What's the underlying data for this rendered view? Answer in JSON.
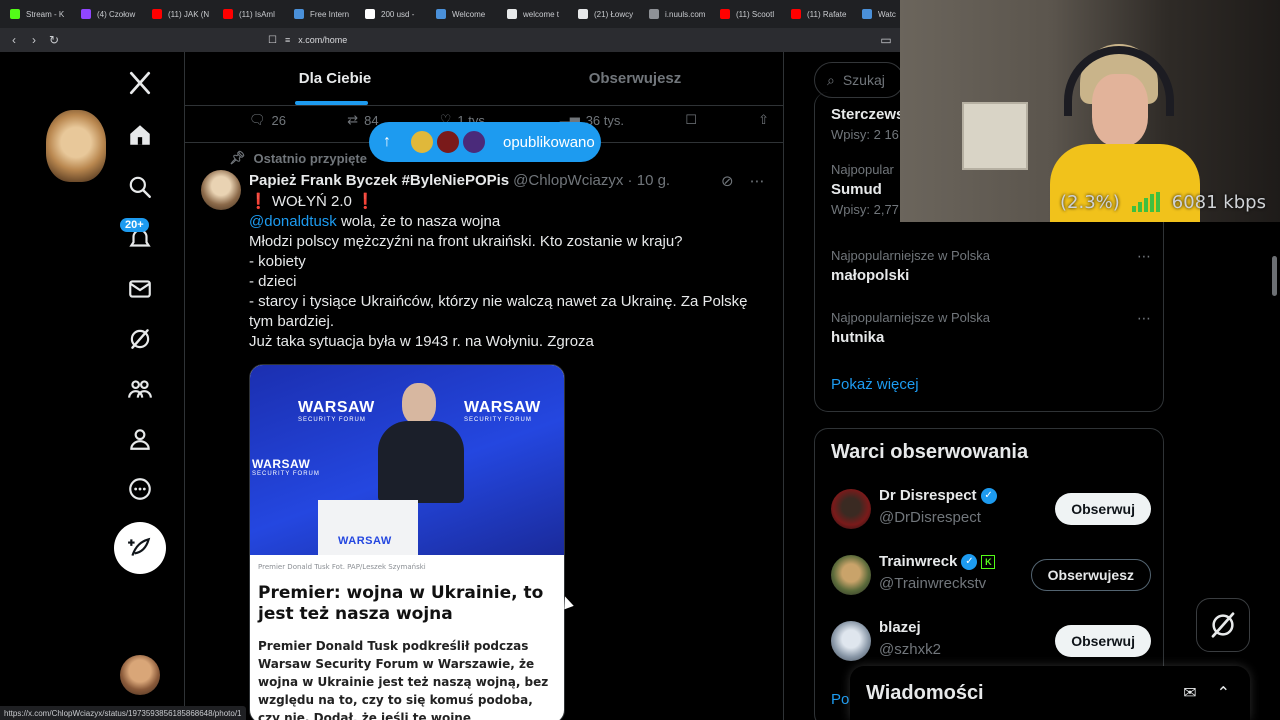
{
  "browser": {
    "tabs": [
      {
        "label": "Stream - K",
        "color": "#53fc18"
      },
      {
        "label": "(4) Czołow",
        "color": "#9146ff"
      },
      {
        "label": "(11) JAK (N",
        "color": "#ff0000"
      },
      {
        "label": "(11) IsAml",
        "color": "#ff0000"
      },
      {
        "label": "Free Intern",
        "color": "#4a90d9"
      },
      {
        "label": "200 usd -",
        "color": "#ffffff"
      },
      {
        "label": "Welcome",
        "color": "#4a90d9"
      },
      {
        "label": "welcome t",
        "color": "#e7e9ea"
      },
      {
        "label": "(21) Łowcy",
        "color": "#e7e9ea"
      },
      {
        "label": "i.nuuls.com",
        "color": "#8e9196"
      },
      {
        "label": "(11) Scootl",
        "color": "#ff0000"
      },
      {
        "label": "(11) Rafate",
        "color": "#ff0000"
      },
      {
        "label": "Watc",
        "color": "#4a90d9"
      }
    ],
    "url": "x.com/home",
    "status_url": "https://x.com/ChlopWciazyx/status/1973593856185868648/photo/1"
  },
  "nav": {
    "notifications_badge": "20+"
  },
  "feed": {
    "tab_for_you": "Dla Ciebie",
    "tab_following": "Obserwujesz",
    "prev_actions": {
      "replies": "26",
      "reposts": "84",
      "likes": "1 tys.",
      "views": "36 tys."
    },
    "new_posts_pill": "opublikowano",
    "pinned_label": "Ostatnio przypięte",
    "tweet": {
      "author_name": "Papież Frank Byczek #ByleNiePOPis",
      "handle_time": "@ChlopWciazyx · 10 g.",
      "line1": "❗ WOŁYŃ 2.0 ❗",
      "mention": "@donaldtusk",
      "line2_rest": " wola, że to nasza wojna",
      "line3": "Młodzi polscy mężczyźni na front ukraiński. Kto zostanie w kraju?",
      "line4": "- kobiety",
      "line5": "- dzieci",
      "line6": "- starcy i tysiące Ukraińców, którzy nie walczą nawet za Ukrainę. Za Polskę tym bardziej.",
      "line7": "Już taka sytuacja była w 1943 r. na Wołyniu. Zgroza",
      "card": {
        "banner_word": "WARSAW",
        "banner_sub": "SECURITY FORUM",
        "caption": "Premier Donald Tusk Fot. PAP/Leszek Szymański",
        "title": "Premier: wojna w Ukrainie, to jest też nasza wojna",
        "body": "Premier Donald Tusk podkreślił podczas Warsaw Security Forum w Warszawie, że wojna w Ukrainie jest też naszą wojną, bez względu na to, czy to się komuś podoba, czy nie. Dodał, że jeśli tę wojnę"
      }
    }
  },
  "sidebar": {
    "search_placeholder": "Szukaj",
    "trends": [
      {
        "category": "",
        "name": "Sterczewsk",
        "sub": "Wpisy: 2 16"
      },
      {
        "category": "Najpopular",
        "name": "Sumud",
        "sub": "Wpisy: 2,77 mln"
      },
      {
        "category": "Najpopularniejsze w Polska",
        "name": "małopolski",
        "sub": ""
      },
      {
        "category": "Najpopularniejsze w Polska",
        "name": "hutnika",
        "sub": ""
      }
    ],
    "show_more": "Pokaż więcej",
    "who_to_follow_title": "Warci obserwowania",
    "follow": [
      {
        "name": "Dr Disrespect",
        "handle": "@DrDisrespect",
        "button": "Obserwuj"
      },
      {
        "name": "Trainwreck",
        "handle": "@Trainwreckstv",
        "button": "Obserwujesz"
      },
      {
        "name": "blazej",
        "handle": "@szhxk2",
        "button": "Obserwuj"
      }
    ],
    "follow_more": "Po"
  },
  "messages": {
    "title": "Wiadomości"
  },
  "overlay": {
    "cpu": "(2.3%)",
    "bitrate": "6081 kbps"
  }
}
